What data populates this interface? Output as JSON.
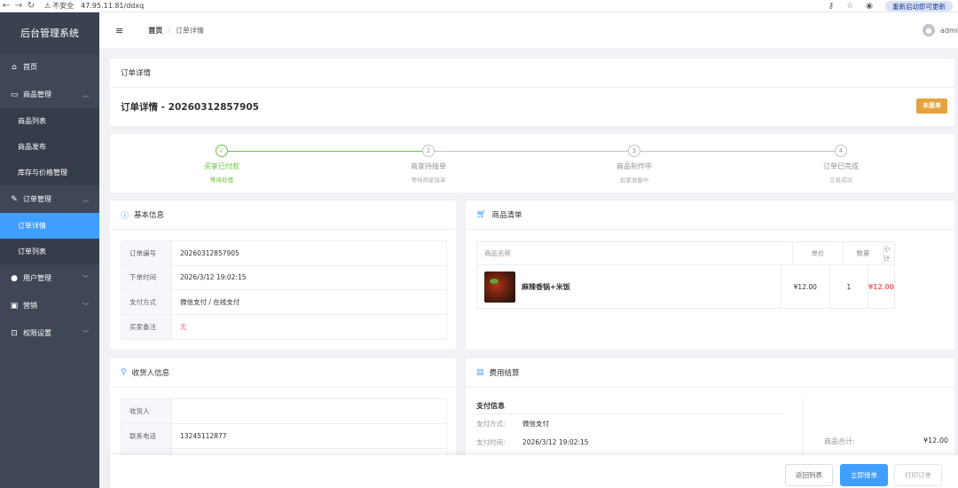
{
  "browser": {
    "security_label": "不安全",
    "url": "47.95.11.81/ddxq",
    "update_label": "重新启动即可更新"
  },
  "sidebar": {
    "title": "后台管理系统",
    "items": [
      {
        "label": "首页",
        "icon": "home-icon"
      },
      {
        "label": "商品管理",
        "icon": "shop-icon",
        "expanded": true
      },
      {
        "label": "商品列表",
        "sub": true
      },
      {
        "label": "商品发布",
        "sub": true
      },
      {
        "label": "库存与价格管理",
        "sub": true
      },
      {
        "label": "订单管理",
        "icon": "edit-icon",
        "expanded": true
      },
      {
        "label": "订单详情",
        "sub": true,
        "active": true
      },
      {
        "label": "订单列表",
        "sub": true
      },
      {
        "label": "用户管理",
        "icon": "user-icon"
      },
      {
        "label": "营销",
        "icon": "gift-icon"
      },
      {
        "label": "权限设置",
        "icon": "lock-icon"
      }
    ]
  },
  "header": {
    "breadcrumb_home": "首页",
    "breadcrumb_sep": "/",
    "breadcrumb_current": "订单详情",
    "user": "admi"
  },
  "order": {
    "card_title": "订单详情",
    "title": "订单详情 - 20260312857905",
    "status": "未接单"
  },
  "steps": [
    {
      "index": "✓",
      "title": "买家已付款",
      "desc": "等待处理",
      "done": true
    },
    {
      "index": "2",
      "title": "商家待接单",
      "desc": "等待商家接单",
      "done": false
    },
    {
      "index": "3",
      "title": "商品制作中",
      "desc": "加紧准备中",
      "done": false
    },
    {
      "index": "4",
      "title": "订单已完成",
      "desc": "交易成功",
      "done": false
    }
  ],
  "basic_info": {
    "title": "基本信息",
    "rows": [
      {
        "label": "订单编号",
        "value": "20260312857905"
      },
      {
        "label": "下单时间",
        "value": "2026/3/12 19:02:15"
      },
      {
        "label": "支付方式",
        "value": "微信支付 / 在线支付"
      },
      {
        "label": "买家备注",
        "value": "无"
      }
    ]
  },
  "product_list": {
    "title": "商品清单",
    "headers": {
      "name": "商品名称",
      "price": "单价",
      "qty": "数量",
      "subtotal": "小计"
    },
    "rows": [
      {
        "name": "麻辣香锅+米饭",
        "price": "¥12.00",
        "qty": "1",
        "subtotal": "¥12.00"
      }
    ]
  },
  "receiver": {
    "title": "收货人信息",
    "rows": [
      {
        "label": "收货人",
        "value": ""
      },
      {
        "label": "联系电话",
        "value": "13245112877"
      }
    ]
  },
  "fee": {
    "title": "费用结算",
    "payment_title": "支付信息",
    "rows": [
      {
        "label": "支付方式:",
        "value": "微信支付"
      },
      {
        "label": "支付时间:",
        "value": "2026/3/12 19:02:15"
      }
    ],
    "goods_total_label": "商品合计:",
    "goods_total_value": "¥12.00"
  },
  "actions": {
    "back": "返回列表",
    "accept": "立即接单",
    "print": "打印订单"
  },
  "colors": {
    "primary": "#409eff",
    "success": "#67c23a",
    "warning": "#e6a23c",
    "danger": "#f56c6c",
    "sidebar": "#3f4756"
  }
}
